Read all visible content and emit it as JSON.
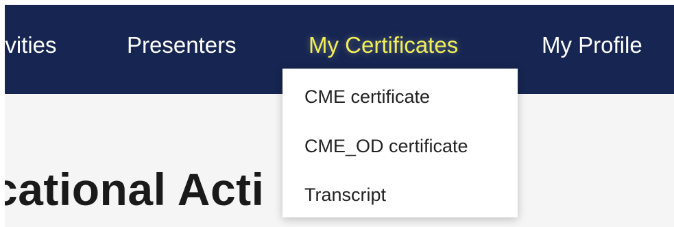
{
  "nav": {
    "items": [
      {
        "label": "ivities",
        "active": false
      },
      {
        "label": "Presenters",
        "active": false
      },
      {
        "label": "My Certificates",
        "active": true
      },
      {
        "label": "My Profile",
        "active": false
      }
    ]
  },
  "dropdown": {
    "items": [
      {
        "label": "CME certificate"
      },
      {
        "label": "CME_OD certificate"
      },
      {
        "label": "Transcript"
      }
    ]
  },
  "main": {
    "title": "cational Acti"
  },
  "colors": {
    "navbar_bg": "#162551",
    "nav_text": "#ffffff",
    "nav_active_text": "#f1ee5b",
    "content_bg": "#f5f5f5",
    "dropdown_bg": "#ffffff"
  }
}
